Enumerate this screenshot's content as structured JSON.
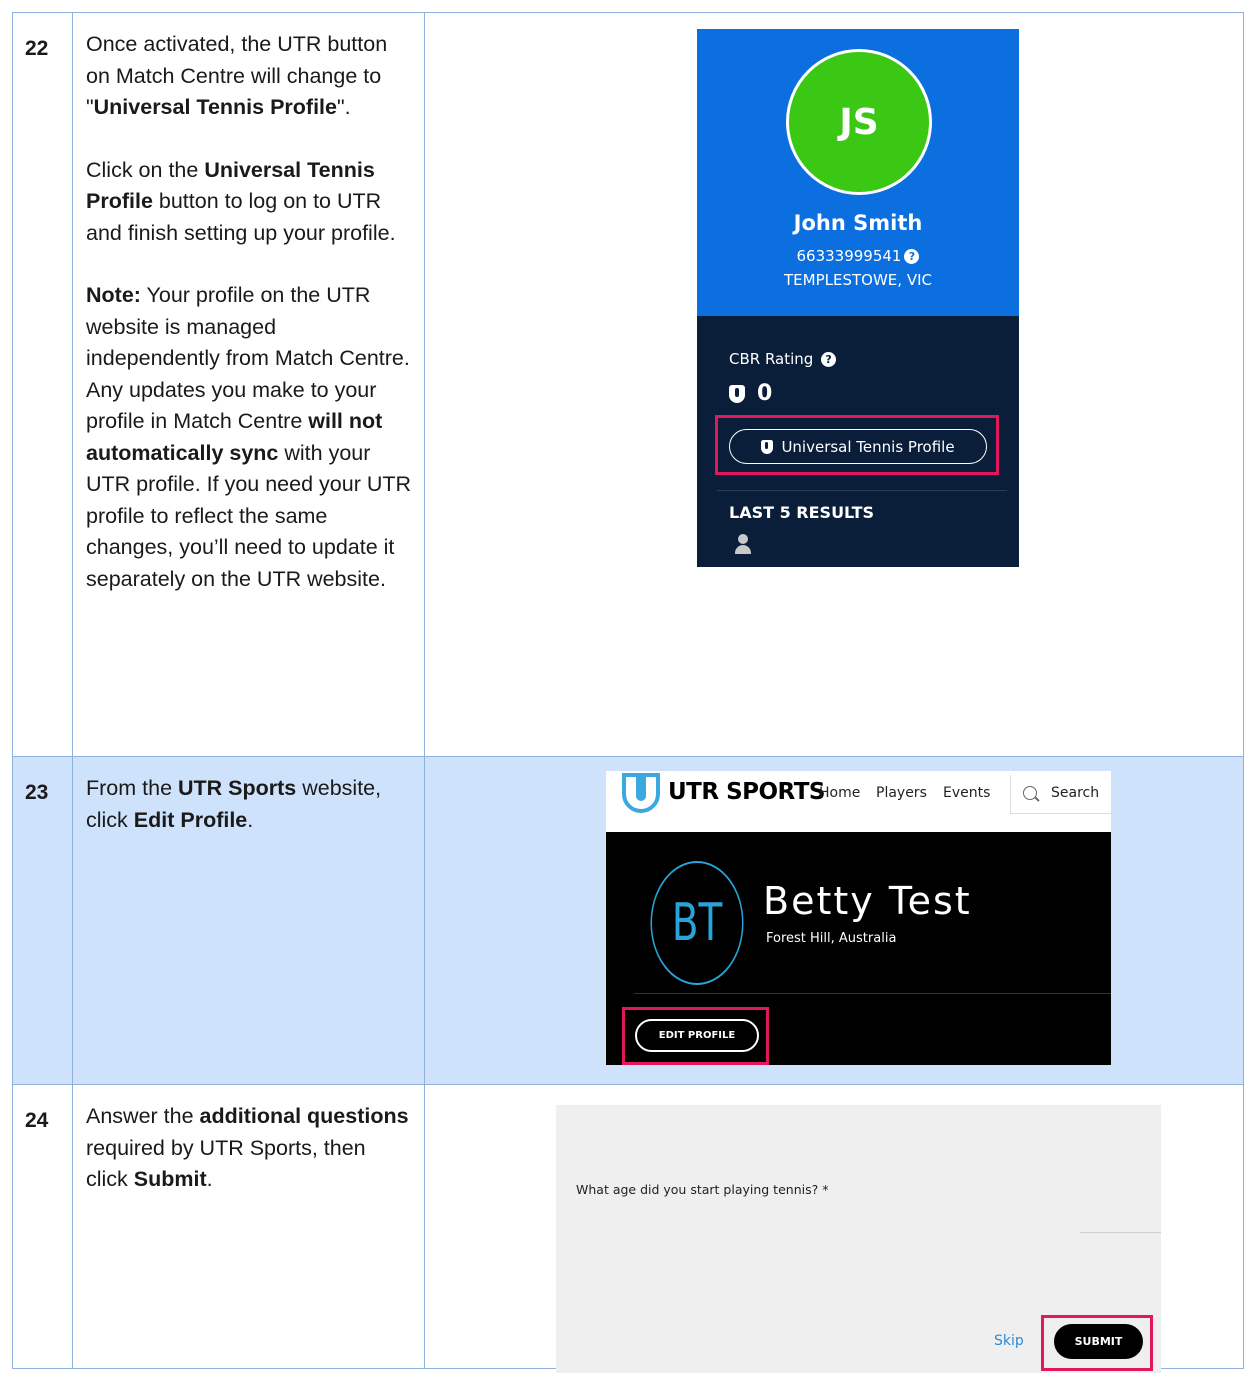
{
  "steps": {
    "s22": {
      "num": "22",
      "p1": [
        "Once activated, the UTR button on Match Centre will change to \"",
        "Universal Tennis Profile",
        "\"."
      ],
      "p2": [
        "Click on the ",
        "Universal Tennis Profile",
        " button to log on to UTR and finish setting up your profile."
      ],
      "p3": [
        "Note:",
        " Your profile on the UTR website is managed independently from Match Centre. Any updates you make to your profile in Match Centre ",
        "will not automatically sync",
        " with your UTR profile. If you need your UTR profile to reflect the same changes, you’ll need to update it separately on the UTR website."
      ]
    },
    "s23": {
      "num": "23",
      "p1": [
        "From the ",
        "UTR Sports",
        " website, click ",
        "Edit Profile",
        "."
      ]
    },
    "s24": {
      "num": "24",
      "p1": [
        "Answer the ",
        "additional questions",
        " required by UTR Sports, then click ",
        "Submit",
        "."
      ]
    }
  },
  "match_centre": {
    "initials": "JS",
    "name": "John Smith",
    "id": "66333999541",
    "location": "TEMPLESTOWE, VIC",
    "rating_label": "CBR Rating",
    "rating_value": "0",
    "utp_button": "Universal Tennis Profile",
    "last_results": "LAST 5 RESULTS",
    "accent": "#0b6fe0",
    "highlight": "#e3175b"
  },
  "utr_site": {
    "logo": "UTR SPORTS",
    "nav": [
      "Home",
      "Players",
      "Events"
    ],
    "search": "Search",
    "initials": "BT",
    "name": "Betty Test",
    "location": "Forest Hill, Australia",
    "edit_button": "EDIT PROFILE"
  },
  "utr_form": {
    "question": "What age did you start playing tennis? *",
    "skip": "Skip",
    "submit": "SUBMIT"
  }
}
